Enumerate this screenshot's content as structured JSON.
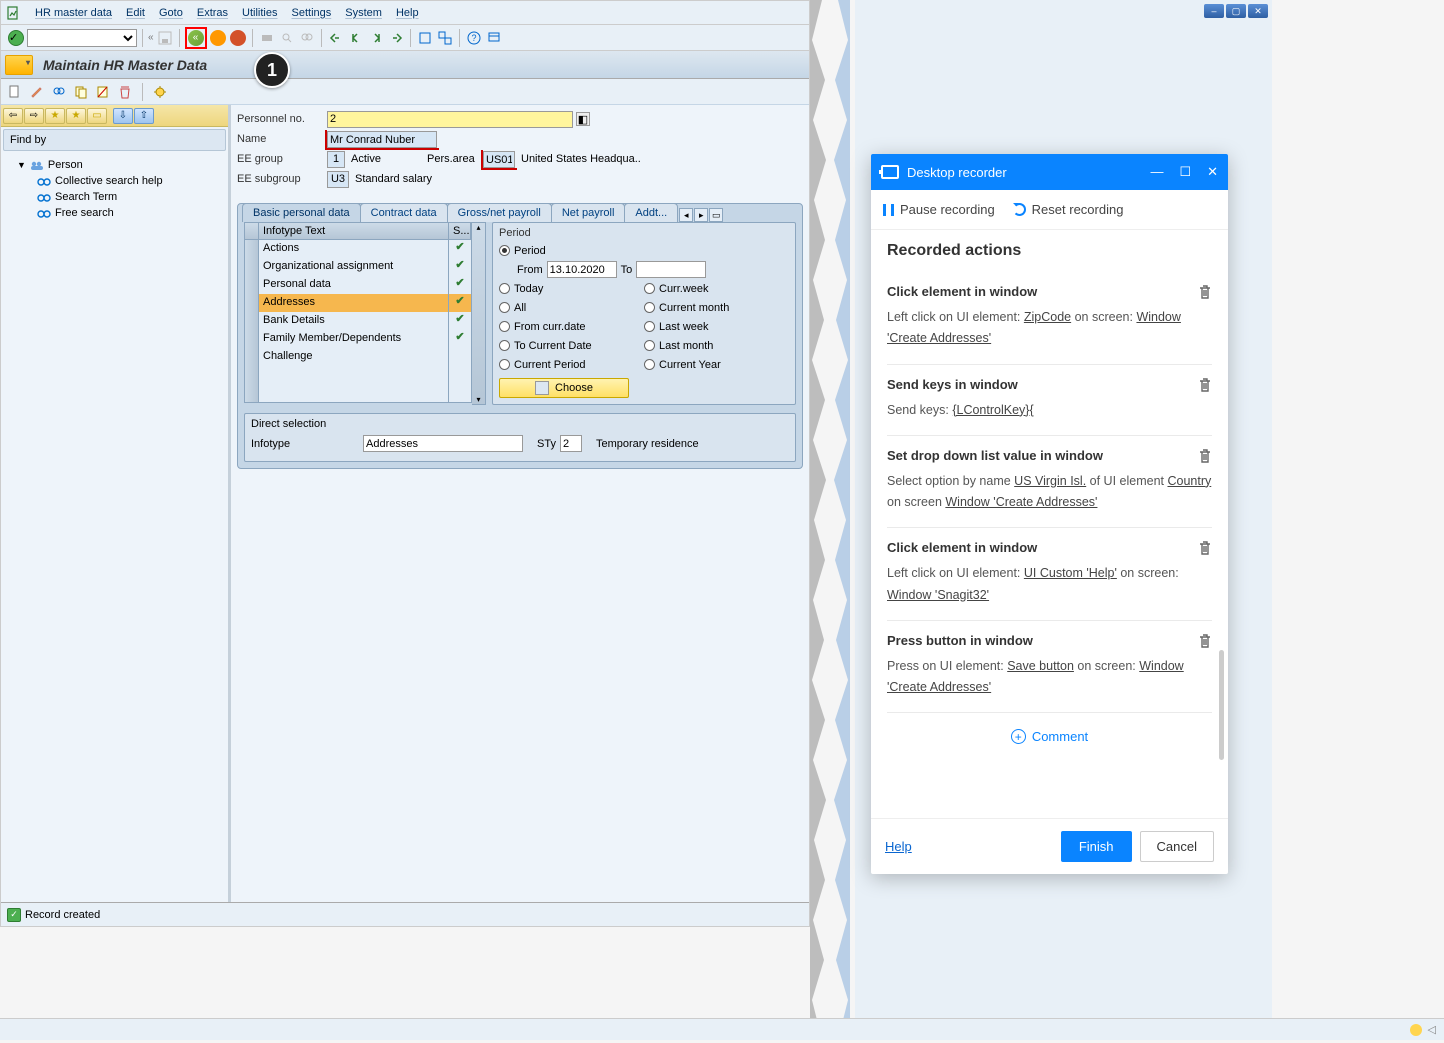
{
  "menubar": [
    "HR master data",
    "Edit",
    "Goto",
    "Extras",
    "Utilities",
    "Settings",
    "System",
    "Help"
  ],
  "page_title": "Maintain HR Master Data",
  "callout": "1",
  "sidebar": {
    "findby_label": "Find by",
    "root": "Person",
    "children": [
      "Collective search help",
      "Search Term",
      "Free search"
    ]
  },
  "header_form": {
    "personnel_no_label": "Personnel no.",
    "personnel_no_value": "2",
    "name_label": "Name",
    "name_value": "Mr Conrad Nuber",
    "ee_group_label": "EE group",
    "ee_group_code": "1",
    "ee_group_text": "Active",
    "pers_area_label": "Pers.area",
    "pers_area_code": "US01",
    "pers_area_text": "United States Headqua..",
    "ee_subgroup_label": "EE subgroup",
    "ee_subgroup_code": "U3",
    "ee_subgroup_text": "Standard salary"
  },
  "tabs": [
    "Basic personal data",
    "Contract data",
    "Gross/net payroll",
    "Net payroll",
    "Addt..."
  ],
  "infotype_table": {
    "col1": "Infotype Text",
    "col2": "S...",
    "rows": [
      {
        "text": "Actions",
        "check": true,
        "selected": false
      },
      {
        "text": "Organizational assignment",
        "check": true,
        "selected": false
      },
      {
        "text": "Personal data",
        "check": true,
        "selected": false
      },
      {
        "text": "Addresses",
        "check": true,
        "selected": true
      },
      {
        "text": "Bank Details",
        "check": true,
        "selected": false
      },
      {
        "text": "Family Member/Dependents",
        "check": true,
        "selected": false
      },
      {
        "text": "Challenge",
        "check": false,
        "selected": false
      },
      {
        "text": "",
        "check": false,
        "selected": false
      },
      {
        "text": "",
        "check": false,
        "selected": false
      }
    ]
  },
  "period": {
    "group": "Period",
    "period_opt": "Period",
    "from_label": "From",
    "from_value": "13.10.2020",
    "to_label": "To",
    "to_value": "",
    "left_opts": [
      "Today",
      "All",
      "From curr.date",
      "To Current Date",
      "Current Period"
    ],
    "right_opts": [
      "Curr.week",
      "Current month",
      "Last week",
      "Last month",
      "Current Year"
    ],
    "choose_label": "Choose"
  },
  "direct_selection": {
    "group": "Direct selection",
    "infotype_label": "Infotype",
    "infotype_value": "Addresses",
    "sty_label": "STy",
    "sty_value": "2",
    "sty_text": "Temporary residence"
  },
  "status_bar": "Record created",
  "recorder": {
    "title": "Desktop recorder",
    "pause": "Pause recording",
    "reset": "Reset recording",
    "heading": "Recorded actions",
    "actions": [
      {
        "title": "Click element in window",
        "parts": [
          "Left click on UI element: ",
          "ZipCode",
          " on screen: ",
          "Window 'Create Addresses'"
        ]
      },
      {
        "title": "Send keys in window",
        "parts": [
          "Send keys: ",
          "{LControlKey}{"
        ]
      },
      {
        "title": "Set drop down list value in window",
        "parts": [
          "Select option by name ",
          "US Virgin Isl.",
          " of UI element ",
          "Country",
          " on screen ",
          "Window 'Create Addresses'"
        ]
      },
      {
        "title": "Click element in window",
        "parts": [
          "Left click on UI element: ",
          "UI Custom 'Help'",
          " on screen: ",
          "Window 'Snagit32'"
        ]
      },
      {
        "title": "Press button in window",
        "parts": [
          "Press on UI element: ",
          "Save button",
          " on screen: ",
          "Window 'Create Addresses'"
        ]
      }
    ],
    "comment": "Comment",
    "help": "Help",
    "finish": "Finish",
    "cancel": "Cancel"
  }
}
